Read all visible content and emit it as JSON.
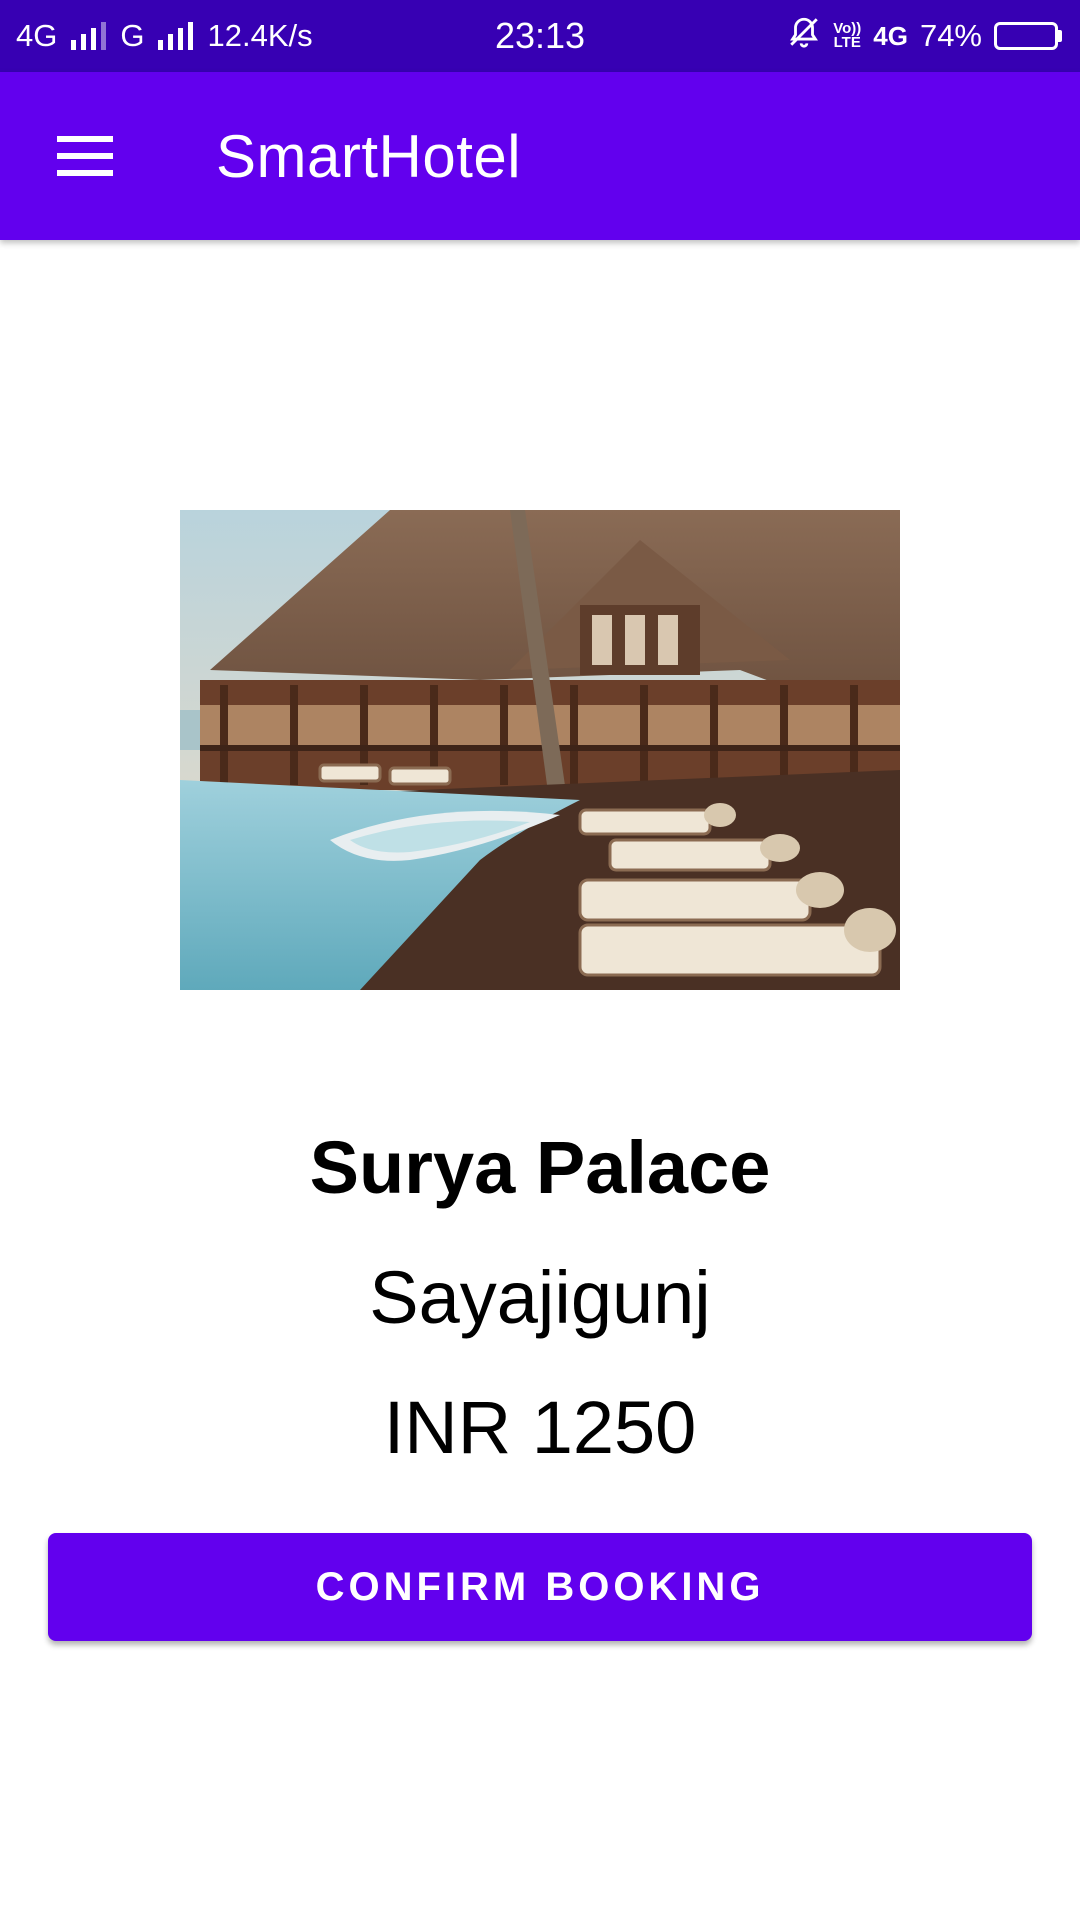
{
  "status_bar": {
    "network1": "4G",
    "network2": "G",
    "speed": "12.4K/s",
    "time": "23:13",
    "volte_top": "Vo))",
    "volte_bottom": "LTE",
    "network3": "4G",
    "battery_percent": "74%",
    "battery_level": 0.74
  },
  "app_bar": {
    "title": "SmartHotel",
    "menu_icon": "hamburger-menu-icon"
  },
  "hotel": {
    "image_alt": "pool-resort-photo",
    "name": "Surya Palace",
    "location": "Sayajigunj",
    "price": "INR 1250"
  },
  "actions": {
    "confirm_label": "CONFIRM BOOKING"
  },
  "colors": {
    "primary": "#6200ee",
    "primary_dark": "#3700b3",
    "on_primary": "#ffffff",
    "text": "#000000"
  }
}
